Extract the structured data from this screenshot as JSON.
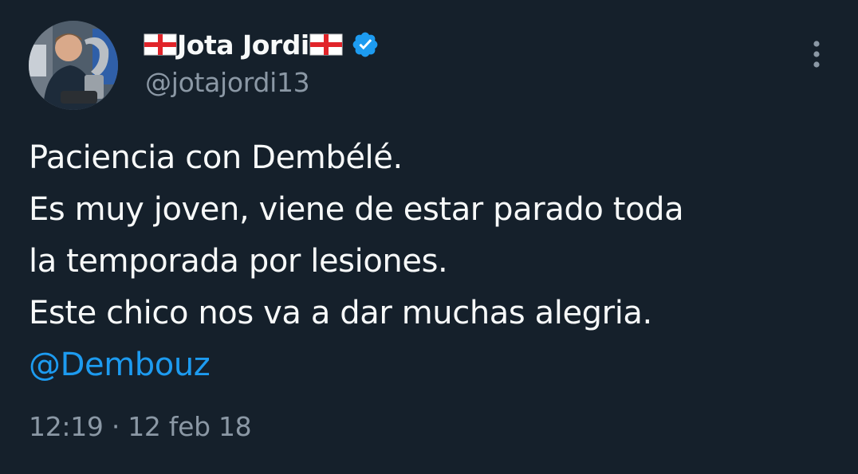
{
  "author": {
    "display_name": "Jota Jordi",
    "handle": "@jotajordi13",
    "verified": true,
    "name_emoji": "flag-england-icon"
  },
  "tweet": {
    "lines": [
      "Paciencia con Dembélé.",
      "Es muy joven, viene de estar parado toda",
      "la temporada por lesiones.",
      "Este chico nos va a dar muchas alegria."
    ],
    "mention": "@Dembouz"
  },
  "meta": {
    "time": "12:19",
    "separator": "·",
    "date": "12 feb 18"
  },
  "colors": {
    "background": "#15202b",
    "text": "#f7f9f9",
    "secondary": "#8b98a5",
    "link": "#1d9bf0",
    "verified": "#1d9bf0"
  },
  "icons": {
    "more": "more-options-icon",
    "verified": "verified-badge-icon"
  }
}
